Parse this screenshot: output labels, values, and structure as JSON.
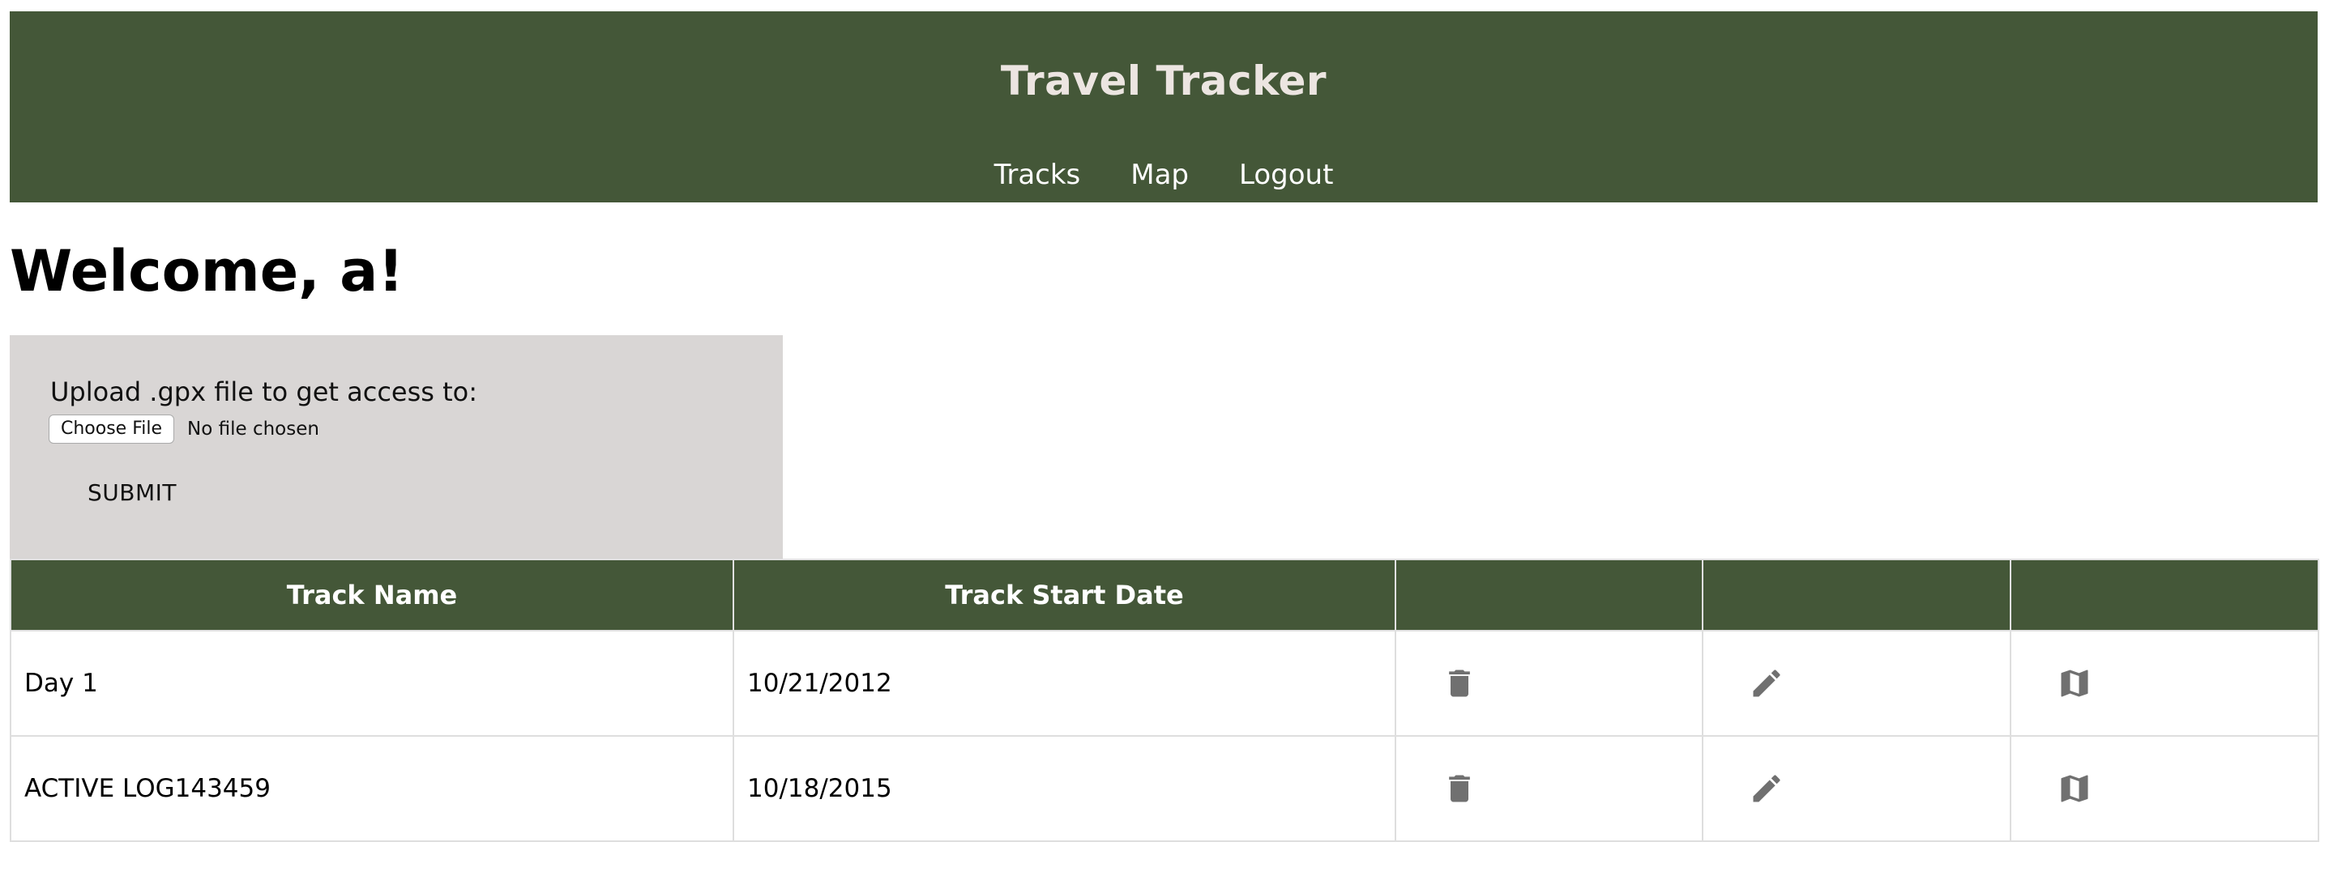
{
  "header": {
    "title": "Travel Tracker",
    "nav": [
      {
        "label": "Tracks"
      },
      {
        "label": "Map"
      },
      {
        "label": "Logout"
      }
    ]
  },
  "welcome": "Welcome, a!",
  "upload": {
    "label": "Upload .gpx file to get access to:",
    "choose_file_label": "Choose File",
    "file_status": "No file chosen",
    "submit_label": "SUBMIT"
  },
  "table": {
    "columns": [
      "Track Name",
      "Track Start Date",
      "",
      "",
      ""
    ],
    "rows": [
      {
        "name": "Day 1",
        "date": "10/21/2012",
        "icons": [
          "trash-icon",
          "pencil-icon",
          "map-icon"
        ]
      },
      {
        "name": "ACTIVE LOG143459",
        "date": "10/18/2015",
        "icons": [
          "trash-icon",
          "pencil-icon",
          "map-icon"
        ]
      }
    ]
  },
  "colors": {
    "header_bg": "#445738",
    "title_text": "#ece5e1",
    "upload_bg": "#d9d6d5",
    "icon": "#707070"
  }
}
